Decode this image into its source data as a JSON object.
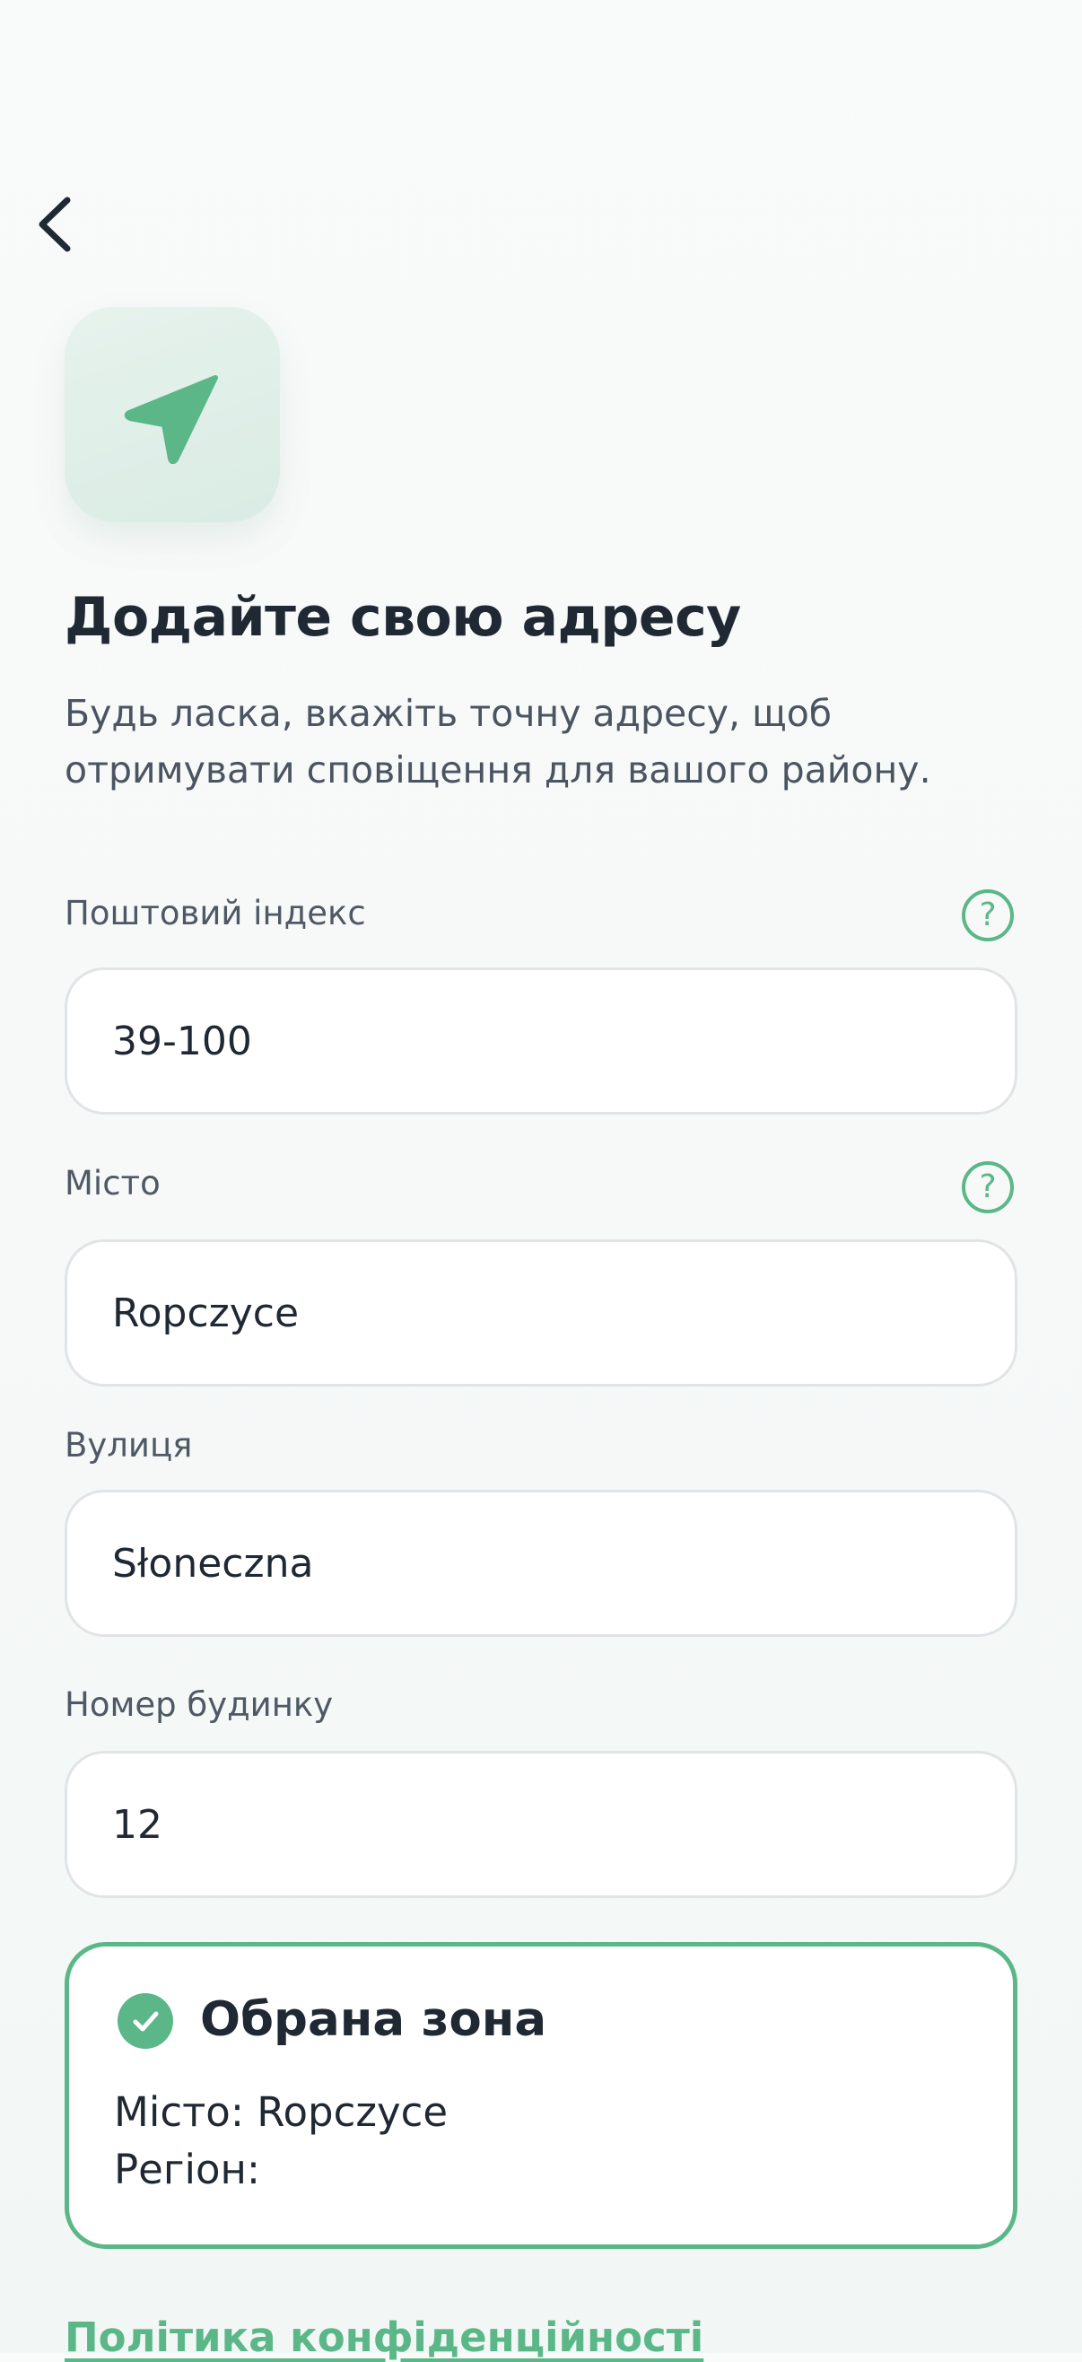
{
  "header": {
    "back_icon": "chevron-left-icon",
    "app_icon": "navigation-arrow-icon"
  },
  "title": "Додайте свою адресу",
  "subtitle": "Будь ласка, вкажіть точну адресу, щоб отримувати сповіщення для вашого району.",
  "fields": {
    "postal_code": {
      "label": "Поштовий індекс",
      "value": "39-100",
      "help_icon": "question-circle-icon"
    },
    "city": {
      "label": "Місто",
      "value": "Ropczyce",
      "help_icon": "question-circle-icon"
    },
    "street": {
      "label": "Вулиця",
      "value": "Słoneczna"
    },
    "house_number": {
      "label": "Номер будинку",
      "value": "12"
    }
  },
  "zone": {
    "icon": "check-circle-icon",
    "title": "Обрана зона",
    "city_line": "Місто: Ropczyce",
    "region_line": "Регіон:"
  },
  "privacy_link": "Політика конфіденційності",
  "colors": {
    "accent": "#5bb788",
    "text": "#1f2833",
    "muted_text": "#4f5865",
    "input_border": "#e1e4e7"
  }
}
